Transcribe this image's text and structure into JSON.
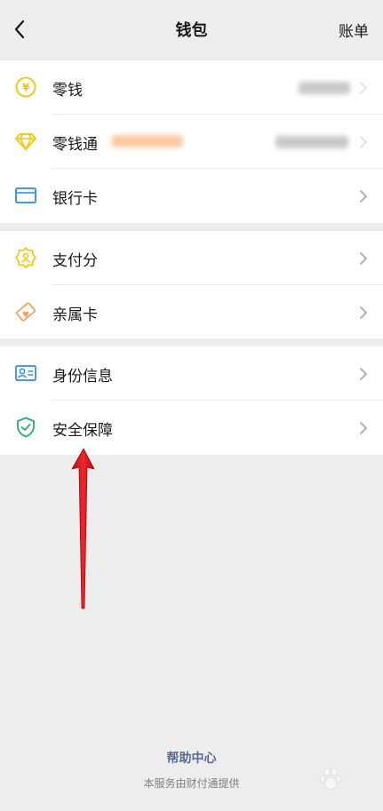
{
  "header": {
    "title": "钱包",
    "bill_label": "账单"
  },
  "groups": [
    {
      "items": [
        {
          "label": "零钱",
          "icon": "coin-yen-icon",
          "value": "¥•••.••"
        },
        {
          "label": "零钱通",
          "icon": "diamond-icon",
          "value": "¥•••••.••"
        },
        {
          "label": "银行卡",
          "icon": "bank-card-icon"
        }
      ]
    },
    {
      "items": [
        {
          "label": "支付分",
          "icon": "pay-score-icon"
        },
        {
          "label": "亲属卡",
          "icon": "family-card-icon"
        }
      ]
    },
    {
      "items": [
        {
          "label": "身份信息",
          "icon": "id-card-icon"
        },
        {
          "label": "安全保障",
          "icon": "shield-check-icon"
        }
      ]
    }
  ],
  "footer": {
    "help_label": "帮助中心",
    "provider_text": "本服务由财付通提供"
  },
  "colors": {
    "accent_yellow": "#f7c300",
    "accent_blue": "#2c8ce6",
    "accent_orange": "#f5a05b",
    "accent_green": "#2aae67",
    "link": "#576b95",
    "annotation_arrow": "#e8161c"
  }
}
